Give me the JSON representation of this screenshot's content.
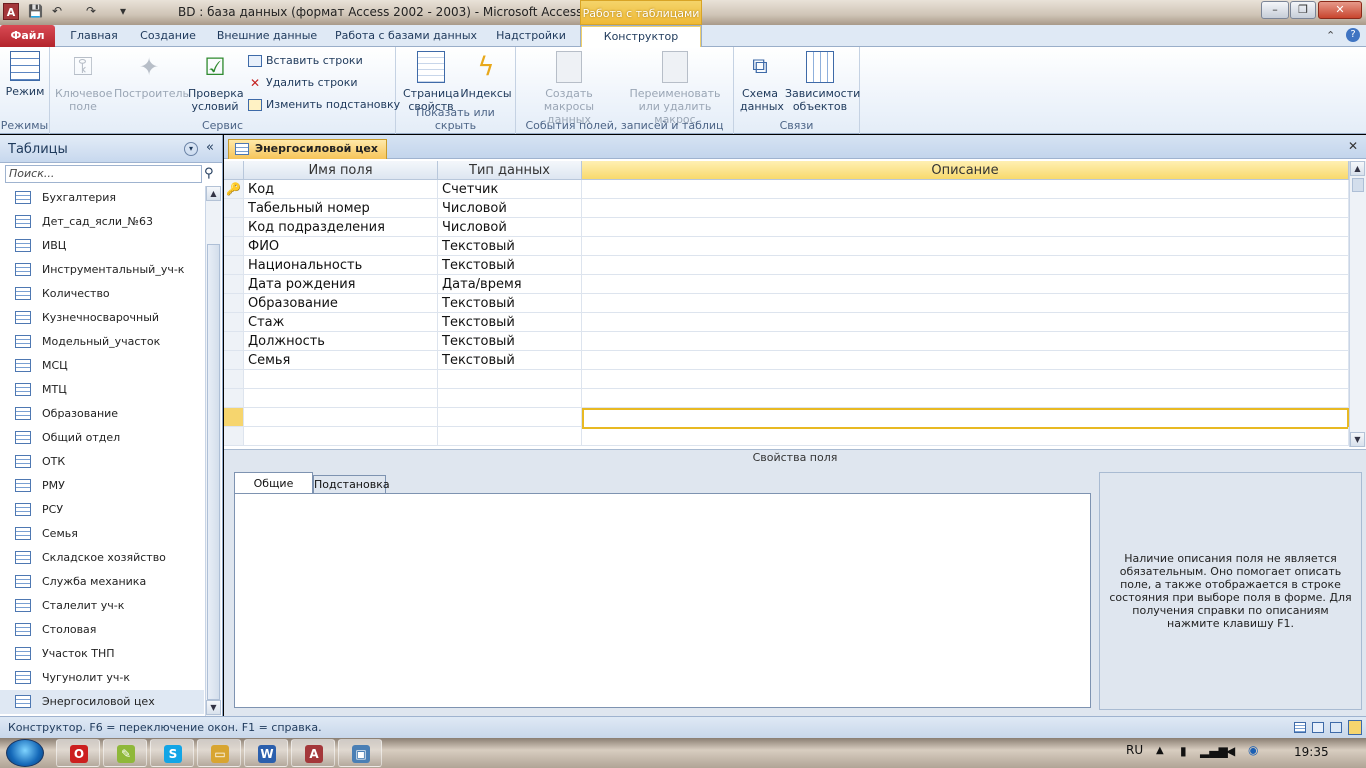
{
  "titlebar": {
    "app_icon": "A",
    "title": "BD : база данных (формат Access 2002 - 2003)  -  Microsoft Access",
    "context_group": "Работа с таблицами",
    "qa_icons": [
      "save-icon",
      "undo-icon",
      "redo-icon",
      "customize-icon"
    ]
  },
  "tabs": {
    "file": "Файл",
    "items": [
      "Главная",
      "Создание",
      "Внешние данные",
      "Работа с базами данных",
      "Надстройки",
      "Конструктор"
    ],
    "active": "Конструктор"
  },
  "ribbon": {
    "groups": {
      "modes": {
        "label": "Режимы",
        "mode": "Режим"
      },
      "service": {
        "label": "Сервис",
        "key_field": "Ключевое поле",
        "builder": "Построитель",
        "check_rules": "Проверка условий",
        "insert_rows": "Вставить строки",
        "delete_rows": "Удалить строки",
        "change_lookup": "Изменить подстановку"
      },
      "show_hide": {
        "label": "Показать или скрыть",
        "property_sheet": "Страница свойств",
        "indexes": "Индексы"
      },
      "events": {
        "label": "События полей, записей и таблиц",
        "create_macros": "Создать макросы данных",
        "rename_macro": "Переименовать или удалить макрос"
      },
      "relations": {
        "label": "Связи",
        "relationships": "Схема данных",
        "dependencies": "Зависимости объектов"
      }
    }
  },
  "nav": {
    "title": "Таблицы",
    "search_placeholder": "Поиск...",
    "items": [
      "Бухгалтерия",
      "Дет_сад_ясли_№63",
      "ИВЦ",
      "Инструментальный_уч-к",
      "Количество",
      "Кузнечносварочный",
      "Модельный_участок",
      "МСЦ",
      "МТЦ",
      "Образование",
      "Общий отдел",
      "ОТК",
      "РМУ",
      "РСУ",
      "Семья",
      "Складское хозяйство",
      "Служба механика",
      "Сталелит уч-к",
      "Столовая",
      "Участок ТНП",
      "Чугунолит уч-к",
      "Энергосиловой цех"
    ],
    "selected": "Энергосиловой цех"
  },
  "document": {
    "tab": "Энергосиловой цех",
    "columns": [
      "Имя поля",
      "Тип данных",
      "Описание"
    ],
    "rows": [
      {
        "name": "Код",
        "type": "Счетчик",
        "key": true
      },
      {
        "name": "Табельный номер",
        "type": "Числовой"
      },
      {
        "name": "Код подразделения",
        "type": "Числовой"
      },
      {
        "name": "ФИО",
        "type": "Текстовый"
      },
      {
        "name": "Национальность",
        "type": "Текстовый"
      },
      {
        "name": "Дата рождения",
        "type": "Дата/время"
      },
      {
        "name": "Образование",
        "type": "Текстовый"
      },
      {
        "name": "Стаж",
        "type": "Текстовый"
      },
      {
        "name": "Должность",
        "type": "Текстовый"
      },
      {
        "name": "Семья",
        "type": "Текстовый"
      }
    ],
    "props_title": "Свойства поля",
    "prop_tabs": [
      "Общие",
      "Подстановка"
    ],
    "help_text": "Наличие описания поля не является обязательным. Оно помогает описать поле, а также отображается в строке состояния при выборе поля в форме. Для получения справки по описаниям нажмите клавишу F1."
  },
  "statusbar": {
    "text": "Конструктор.  F6 = переключение окон.  F1 = справка."
  },
  "taskbar": {
    "apps": [
      {
        "name": "opera",
        "glyph": "O",
        "color": "#cc1f1f"
      },
      {
        "name": "sticky-notes",
        "glyph": "✎",
        "color": "#8fb83a"
      },
      {
        "name": "skype",
        "glyph": "S",
        "color": "#12a5e6"
      },
      {
        "name": "explorer",
        "glyph": "▭",
        "color": "#d8a531"
      },
      {
        "name": "word",
        "glyph": "W",
        "color": "#2b5fad"
      },
      {
        "name": "access",
        "glyph": "A",
        "color": "#a4373a"
      },
      {
        "name": "window",
        "glyph": "▣",
        "color": "#4a7fb5"
      }
    ],
    "lang": "RU",
    "clock": "19:35"
  }
}
